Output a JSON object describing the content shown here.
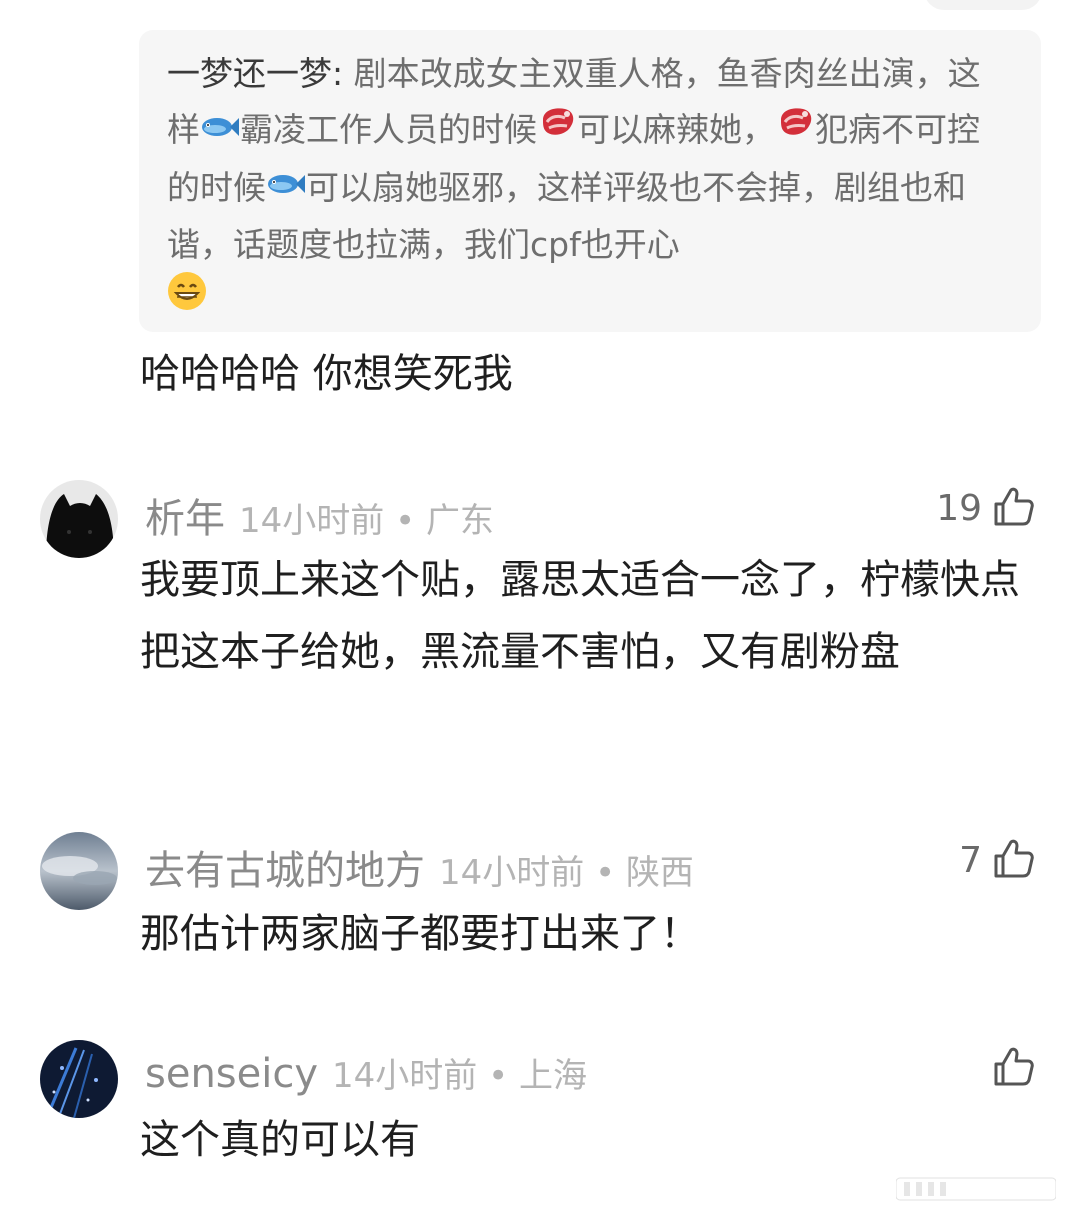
{
  "quote": {
    "author": "一梦还一梦:",
    "segments": [
      " 剧本改成女主双重人格，鱼香肉丝出演，这样",
      "霸凌工作人员的时候",
      "可以麻辣她，",
      "犯病不可控的时候",
      "可以扇她驱邪，这样评级也不会掉，剧组也和谐，话题度也拉满，我们cpf也开心"
    ],
    "icons": [
      "fish-icon",
      "steak-icon",
      "steak-icon",
      "fish-icon",
      "grin-icon"
    ]
  },
  "reply": {
    "text": "哈哈哈哈 你想笑死我"
  },
  "comments": [
    {
      "username": "析年",
      "time": "14小时前",
      "location": "广东",
      "likes": "19",
      "text": "我要顶上来这个贴，露思太适合一念了，柠檬快点把这本子给她，黑流量不害怕，又有剧粉盘",
      "avatar": "black-cat-avatar"
    },
    {
      "username": "去有古城的地方",
      "time": "14小时前",
      "location": "陕西",
      "likes": "7",
      "text": "那估计两家脑子都要打出来了！",
      "avatar": "sky-avatar"
    },
    {
      "username": "senseicy",
      "time": "14小时前",
      "location": "上海",
      "likes": "",
      "text": "这个真的可以有",
      "avatar": "city-night-avatar"
    }
  ],
  "meta_separator": " • ",
  "like_icon": "thumbs-up-icon",
  "colors": {
    "quote_bg": "#f6f6f6",
    "username": "#8a8a8a",
    "meta": "#b4b4b4",
    "body": "#1f1f1f"
  }
}
